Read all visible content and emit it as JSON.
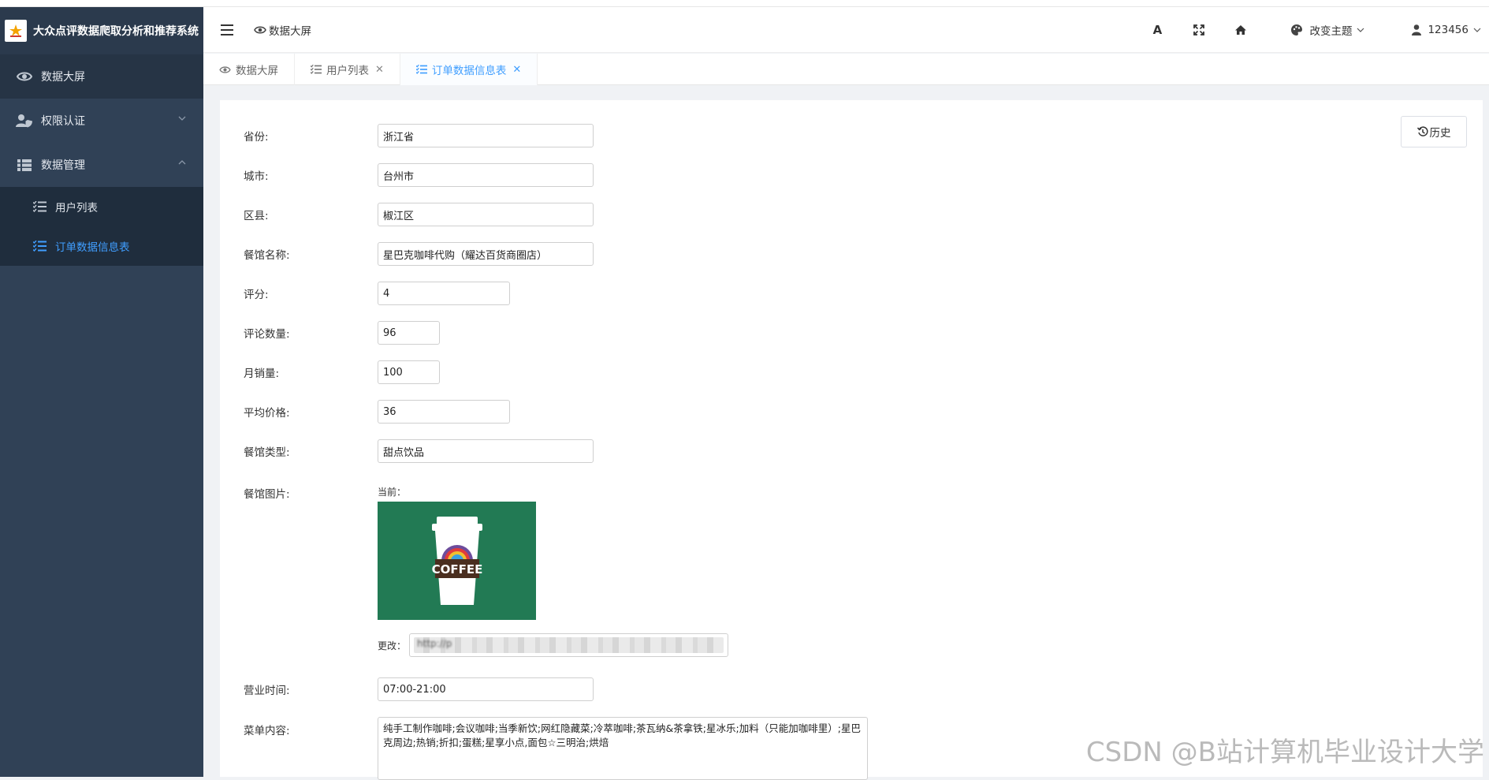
{
  "app": {
    "title": "大众点评数据爬取分析和推荐系统"
  },
  "sidebar": {
    "items": [
      {
        "label": "数据大屏",
        "icon": "eye-icon"
      },
      {
        "label": "权限认证",
        "icon": "user-shield-icon"
      },
      {
        "label": "数据管理",
        "icon": "table-icon"
      }
    ],
    "sub_items": [
      {
        "label": "用户列表",
        "icon": "list-icon"
      },
      {
        "label": "订单数据信息表",
        "icon": "list-icon"
      }
    ]
  },
  "header": {
    "breadcrumb": "数据大屏",
    "font_icon_label": "A",
    "theme_label": "改变主题",
    "user_label": "123456"
  },
  "tabs": [
    {
      "label": "数据大屏",
      "closable": false
    },
    {
      "label": "用户列表",
      "closable": true
    },
    {
      "label": "订单数据信息表",
      "closable": true
    }
  ],
  "form": {
    "history_button": "历史",
    "fields": [
      {
        "label": "省份:",
        "value": "浙江省"
      },
      {
        "label": "城市:",
        "value": "台州市"
      },
      {
        "label": "区县:",
        "value": "椒江区"
      },
      {
        "label": "餐馆名称:",
        "value": "星巴克咖啡代购（耀达百货商圈店）"
      },
      {
        "label": "评分:",
        "value": "4"
      },
      {
        "label": "评论数量:",
        "value": "96"
      },
      {
        "label": "月销量:",
        "value": "100"
      },
      {
        "label": "平均价格:",
        "value": "36"
      },
      {
        "label": "餐馆类型:",
        "value": "甜点饮品"
      }
    ],
    "image_label": "餐馆图片:",
    "current_label": "当前：",
    "image_text": "COFFEE",
    "change_label": "更改：",
    "change_value": "http://p",
    "hours_label": "营业时间:",
    "hours_value": "07:00-21:00",
    "menu_label": "菜单内容:",
    "menu_value": "纯手工制作咖啡;会议咖啡;当季新饮;网红隐藏菜;冷萃咖啡;茶瓦纳&茶拿铁;星冰乐;加料（只能加咖啡里）;星巴克周边;热销;折扣;蛋糕;星享小点,面包☆三明治;烘焙"
  },
  "watermark": "CSDN @B站计算机毕业设计大学",
  "colors": {
    "sidebar_bg": "#304156",
    "accent": "#409eff",
    "image_bg": "#227a54"
  }
}
